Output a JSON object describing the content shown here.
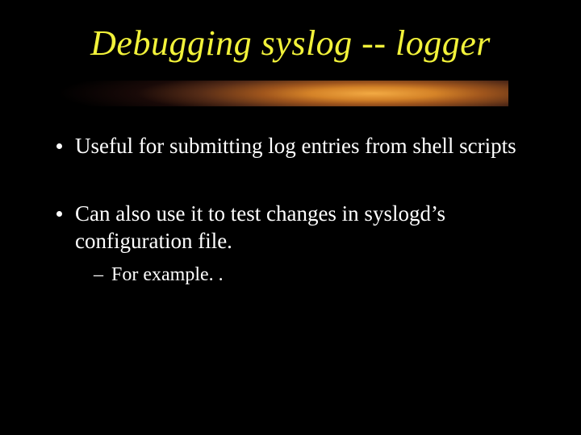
{
  "slide": {
    "title": "Debugging syslog --  logger",
    "bullets": [
      {
        "text": "Useful for submitting log entries from shell scripts",
        "sub": []
      },
      {
        "text": "Can also use it to test changes in syslogd’s configuration file.",
        "sub": [
          {
            "text": "For example. ."
          }
        ]
      }
    ]
  }
}
